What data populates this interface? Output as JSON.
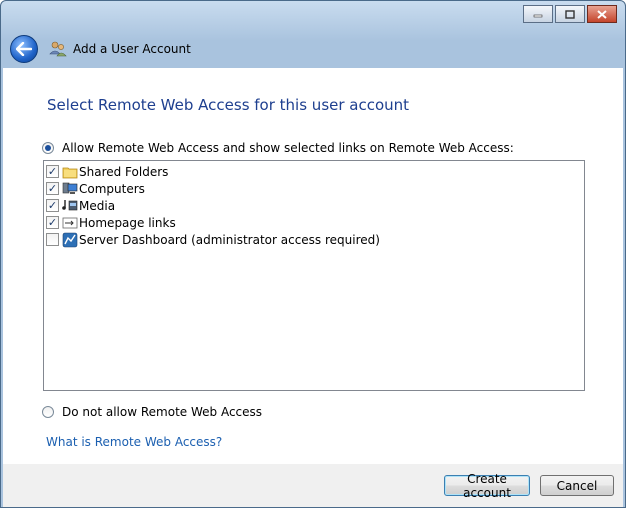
{
  "window": {
    "title": "Add a User Account",
    "caption_icons": [
      "minimize-icon",
      "maximize-icon",
      "close-icon"
    ]
  },
  "main": {
    "heading": "Select Remote Web Access for this user account",
    "allow_option": {
      "label": "Allow Remote Web Access and show selected links on Remote Web Access:",
      "selected": true
    },
    "links": [
      {
        "label": "Shared Folders",
        "checked": true,
        "icon": "folder-icon"
      },
      {
        "label": "Computers",
        "checked": true,
        "icon": "computers-icon"
      },
      {
        "label": "Media",
        "checked": true,
        "icon": "media-icon"
      },
      {
        "label": "Homepage links",
        "checked": true,
        "icon": "homepage-links-icon"
      },
      {
        "label": "Server Dashboard (administrator access required)",
        "checked": false,
        "icon": "server-dashboard-icon"
      }
    ],
    "deny_option": {
      "label": "Do not allow Remote Web Access",
      "selected": false
    },
    "help_link": "What is Remote Web Access?"
  },
  "footer": {
    "create_label": "Create account",
    "cancel_label": "Cancel"
  },
  "colors": {
    "heading": "#1e3f8f",
    "link": "#1b5fb0",
    "title_bar": "#a9c3de"
  }
}
